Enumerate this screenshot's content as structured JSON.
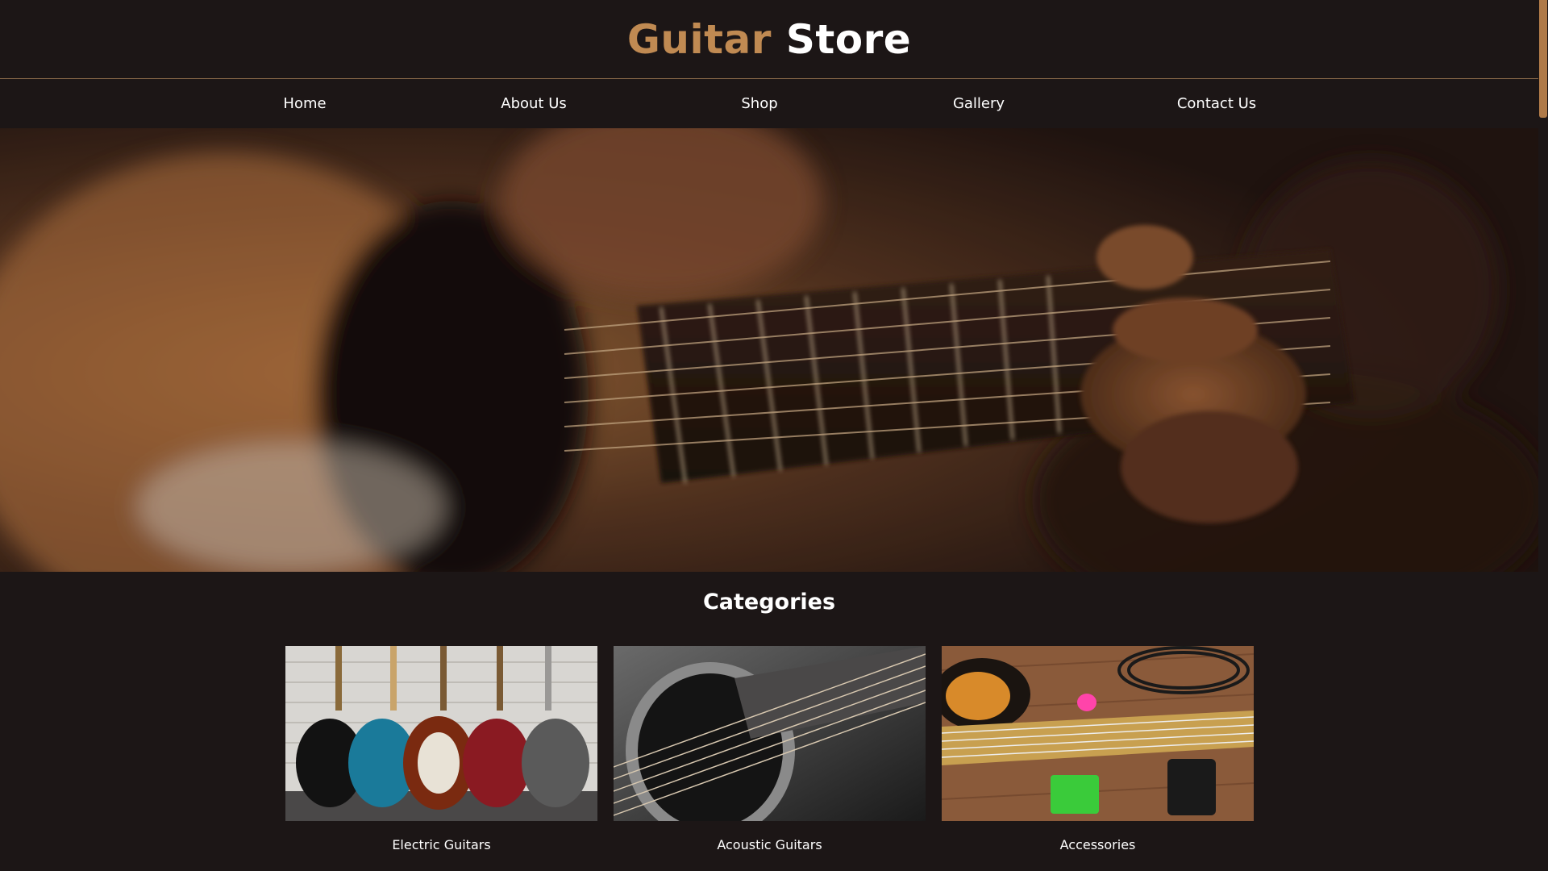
{
  "site": {
    "brand_accent": "Guitar",
    "brand_main": "Store"
  },
  "nav": {
    "items": [
      {
        "label": "Home"
      },
      {
        "label": "About Us"
      },
      {
        "label": "Shop"
      },
      {
        "label": "Gallery"
      },
      {
        "label": "Contact Us"
      }
    ]
  },
  "categories": {
    "title": "Categories",
    "items": [
      {
        "label": "Electric Guitars",
        "icon": "electric-guitars-image"
      },
      {
        "label": "Acoustic Guitars",
        "icon": "acoustic-guitar-image"
      },
      {
        "label": "Accessories",
        "icon": "accessories-image"
      }
    ]
  },
  "colors": {
    "background": "#1c1616",
    "accent": "#c08a52",
    "divider": "#8a6a4a",
    "text": "#ffffff"
  }
}
